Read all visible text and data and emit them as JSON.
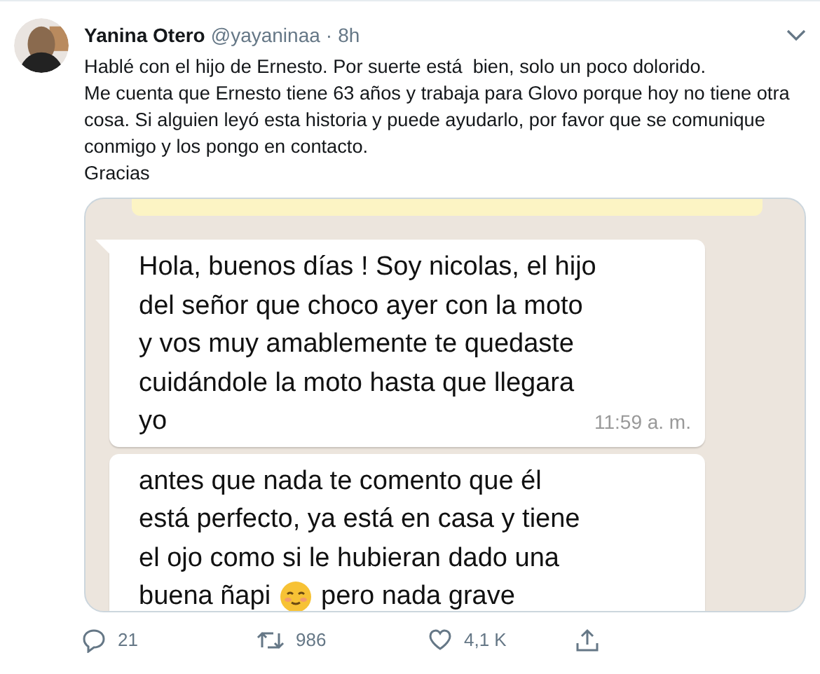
{
  "tweet": {
    "author": "Yanina Otero",
    "handle": "@yayaninaa",
    "separator": "·",
    "time": "8h",
    "text": "Hablé con el hijo de Ernesto. Por suerte está  bien, solo un poco dolorido.\nMe cuenta que Ernesto tiene 63 años y trabaja para Glovo porque hoy no tiene otra cosa. Si alguien leyó esta historia y puede ayudarlo, por favor que se comunique conmigo y los pongo en contacto.\nGracias"
  },
  "chat": {
    "messages": [
      {
        "tail": true,
        "time": "11:59 a. m.",
        "lines": [
          {
            "text": "Hola, buenos días ! Soy nicolas, el hijo"
          },
          {
            "text": "del señor que choco ayer con la moto"
          },
          {
            "text": "y vos muy amablemente te quedaste"
          },
          {
            "text": "cuidándole la moto hasta que llegara"
          },
          {
            "text": "yo"
          }
        ]
      },
      {
        "tail": false,
        "lines": [
          {
            "text": "antes que nada te comento que él"
          },
          {
            "text": "está perfecto, ya está en casa y tiene"
          },
          {
            "text": "el ojo como si le hubieran dado una"
          },
          {
            "text": "buena ñapi",
            "emoji": true,
            "text_after": "pero nada grave"
          }
        ]
      }
    ]
  },
  "actions": {
    "replies": "21",
    "retweets": "986",
    "likes": "4,1 K"
  }
}
